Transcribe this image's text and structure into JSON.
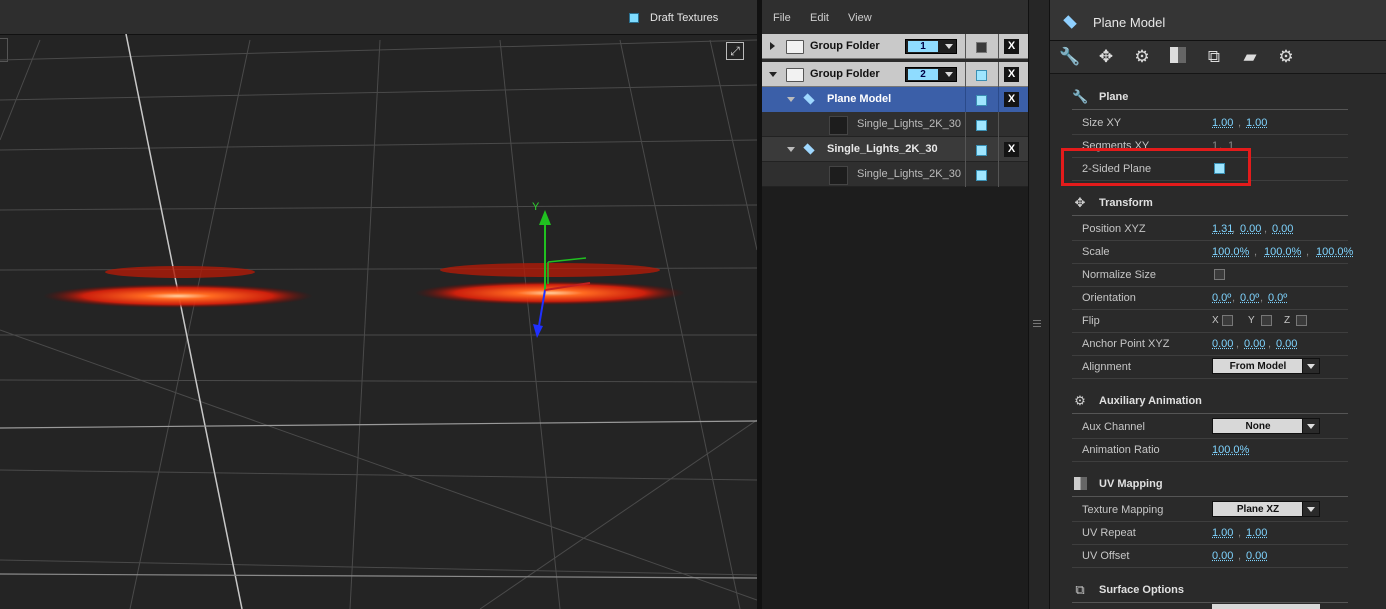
{
  "viewport": {
    "draft_textures_label": "Draft Textures",
    "draft_textures_checked": true
  },
  "layers": {
    "menu": [
      "File",
      "Edit",
      "View"
    ],
    "rows": [
      {
        "type": "group",
        "label": "Group Folder",
        "number": "1",
        "expanded": false
      },
      {
        "type": "group",
        "label": "Group Folder",
        "number": "2",
        "expanded": true
      },
      {
        "type": "model-selected",
        "label": "Plane Model"
      },
      {
        "type": "sublayer",
        "label": "Single_Lights_2K_30"
      },
      {
        "type": "model",
        "label": "Single_Lights_2K_30"
      },
      {
        "type": "sublayer",
        "label": "Single_Lights_2K_30"
      }
    ],
    "close_label": "X"
  },
  "properties": {
    "title": "Plane Model",
    "tools": [
      "wrench-icon",
      "move-icon",
      "gears-icon",
      "checker-icon",
      "uv-icon",
      "surface-icon",
      "settings-icon"
    ],
    "plane": {
      "section": "Plane",
      "size_label": "Size XY",
      "size_x": "1.00",
      "size_y": "1.00",
      "segments_label": "Segments XY",
      "seg_x": "1",
      "seg_y": "1",
      "two_sided_label": "2-Sided Plane",
      "two_sided": true
    },
    "transform": {
      "section": "Transform",
      "position_label": "Position XYZ",
      "pos": [
        "1.31",
        "0.00",
        "0.00"
      ],
      "scale_label": "Scale",
      "scale": [
        "100.0%",
        "100.0%",
        "100.0%"
      ],
      "normalize_label": "Normalize Size",
      "orientation_label": "Orientation",
      "orient": [
        "0.0º",
        "0.0º",
        "0.0º"
      ],
      "flip_label": "Flip",
      "flip_axes": [
        "X",
        "Y",
        "Z"
      ],
      "anchor_label": "Anchor Point XYZ",
      "anchor": [
        "0.00",
        "0.00",
        "0.00"
      ],
      "alignment_label": "Alignment",
      "alignment": "From Model"
    },
    "aux": {
      "section": "Auxiliary Animation",
      "channel_label": "Aux Channel",
      "channel": "None",
      "ratio_label": "Animation Ratio",
      "ratio": "100.0%"
    },
    "uv": {
      "section": "UV Mapping",
      "texture_label": "Texture Mapping",
      "texture": "Plane XZ",
      "repeat_label": "UV Repeat",
      "repeat": [
        "1.00",
        "1.00"
      ],
      "offset_label": "UV Offset",
      "offset": [
        "0.00",
        "0.00"
      ]
    },
    "surface": {
      "section": "Surface Options"
    }
  },
  "separator": ","
}
